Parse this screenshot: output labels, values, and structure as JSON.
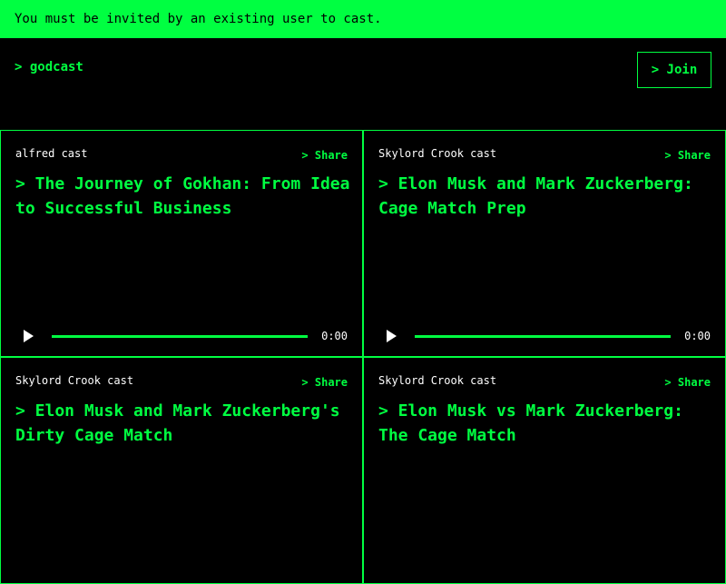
{
  "banner": {
    "text": "You must be invited by an existing user to cast."
  },
  "header": {
    "brand": "> godcast",
    "join_label": "> Join"
  },
  "colors": {
    "accent": "#00ff41",
    "background": "#000000",
    "text": "#ffffff"
  },
  "cards": [
    {
      "author": "alfred cast",
      "share_label": "> Share",
      "title": "> The Journey of Gokhan: From Idea to Successful Business",
      "time": "0:00"
    },
    {
      "author": "Skylord Crook cast",
      "share_label": "> Share",
      "title": "> Elon Musk and Mark Zuckerberg: Cage Match Prep",
      "time": "0:00"
    },
    {
      "author": "Skylord Crook cast",
      "share_label": "> Share",
      "title": "> Elon Musk and Mark Zuckerberg's Dirty Cage Match"
    },
    {
      "author": "Skylord Crook cast",
      "share_label": "> Share",
      "title": "> Elon Musk vs Mark Zuckerberg: The Cage Match"
    }
  ],
  "icons": {
    "play": "play-icon"
  }
}
